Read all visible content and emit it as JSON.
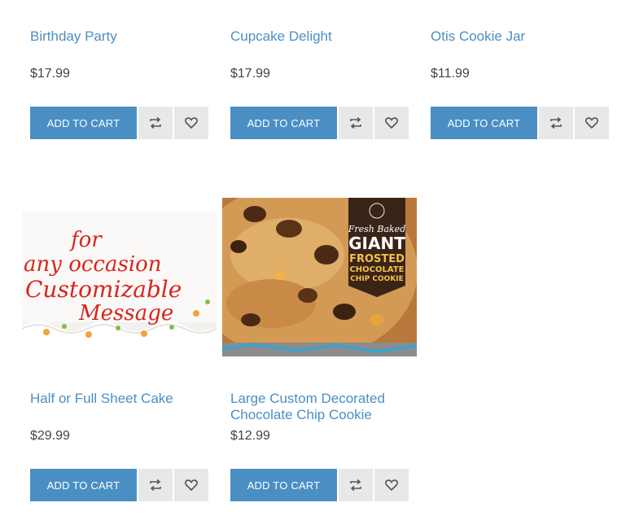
{
  "products": [
    {
      "title": "Birthday Party",
      "price": "$17.99",
      "add_label": "ADD TO CART"
    },
    {
      "title": "Cupcake Delight",
      "price": "$17.99",
      "add_label": "ADD TO CART"
    },
    {
      "title": "Otis Cookie Jar",
      "price": "$11.99",
      "add_label": "ADD TO CART"
    },
    {
      "title": "Half or Full Sheet Cake",
      "price": "$29.99",
      "add_label": "ADD TO CART",
      "image_text": [
        "for",
        "any occasion",
        "Customizable",
        "Message"
      ]
    },
    {
      "title": "Large Custom Decorated Chocolate Chip Cookie",
      "price": "$12.99",
      "add_label": "ADD TO CART",
      "image_text": [
        "Fresh Baked",
        "GIANT",
        "FROSTED",
        "CHOCOLATE",
        "CHIP COOKIE"
      ]
    }
  ],
  "colors": {
    "accent": "#4a8fc4",
    "icon_bg": "#e8e8e8",
    "price_text": "#444444"
  },
  "icons": {
    "compare": "compare-arrows-icon",
    "wishlist": "heart-icon"
  }
}
